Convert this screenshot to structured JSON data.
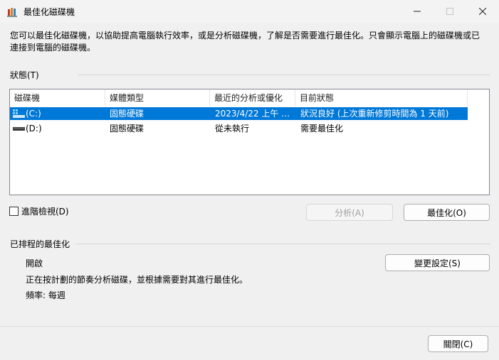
{
  "window": {
    "title": "最佳化磁碟機",
    "icon": "defrag-app-icon"
  },
  "intro": "您可以最佳化磁碟機，以協助提高電腦執行效率，或是分析磁碟機，了解是否需要進行最佳化。只會顯示電腦上的磁碟機或已連接到電腦的磁碟機。",
  "status": {
    "section_label": "狀態(T)",
    "columns": [
      "磁碟機",
      "媒體類型",
      "最近的分析或優化",
      "目前狀態"
    ],
    "rows": [
      {
        "drive": "(C:)",
        "media": "固態硬碟",
        "last": "2023/4/22 上午 1...",
        "state": "狀況良好 (上次重新修剪時間為 1 天前)",
        "selected": true,
        "icon": "windows-drive-icon"
      },
      {
        "drive": "(D:)",
        "media": "固態硬碟",
        "last": "從未執行",
        "state": "需要最佳化",
        "selected": false,
        "icon": "drive-icon"
      }
    ],
    "advanced_view": "進階檢視(D)",
    "analyze_button": "分析(A)",
    "optimize_button": "最佳化(O)"
  },
  "schedule": {
    "section_label": "已排程的最佳化",
    "status": "開啟",
    "description": "正在按計劃的節奏分析磁碟，並根據需要對其進行最佳化。",
    "frequency": "頻率: 每週",
    "change_button": "變更設定(S)"
  },
  "footer": {
    "close_button": "關閉(C)"
  },
  "colors": {
    "selection": "#0078d7",
    "background": "#f0f0f0"
  }
}
